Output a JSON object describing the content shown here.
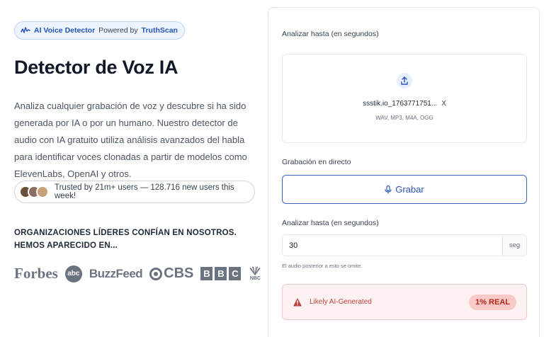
{
  "badge": {
    "brand": "AI Voice Detector",
    "by": "Powered by",
    "company": "TruthScan"
  },
  "hero": {
    "title": "Detector de Voz IA",
    "description": "Analiza cualquier grabación de voz y descubre si ha sido generada por IA o por un humano. Nuestro detector de audio con IA gratuito utiliza análisis avanzados del habla para identificar voces clonadas a partir de modelos como ElevenLabs, OpenAI y otros."
  },
  "trust": {
    "text": "Trusted by 21m+ users — 128.716 new users this week!"
  },
  "orgs": {
    "heading": "ORGANIZACIONES LÍDERES CONFÍAN EN NOSOTROS. HEMOS APARECIDO EN...",
    "logos": {
      "forbes": "Forbes",
      "abc": "abc",
      "buzzfeed": "BuzzFeed",
      "cbs": "CBS",
      "bbc": [
        "B",
        "B",
        "C"
      ],
      "nbc": "NBC"
    }
  },
  "card": {
    "analyze_label": "Analizar hasta (en segundos)",
    "upload": {
      "filename": "ssstik.io_1763771751...",
      "remove": "X",
      "formats": "WAV, MP3, M4A, OGG"
    },
    "live_label": "Grabación en directo",
    "record_button": "Grabar",
    "seconds_label": "Analizar hasta (en segundos)",
    "seconds_value": "30",
    "seconds_unit": "seg",
    "hint": "El audio posterior a esto se omite.",
    "result": {
      "text": "Likely AI-Generated",
      "badge": "1% REAL"
    }
  },
  "colors": {
    "accent": "#2f57b8",
    "danger": "#c2413c",
    "danger_bg": "#fdf1f1"
  }
}
